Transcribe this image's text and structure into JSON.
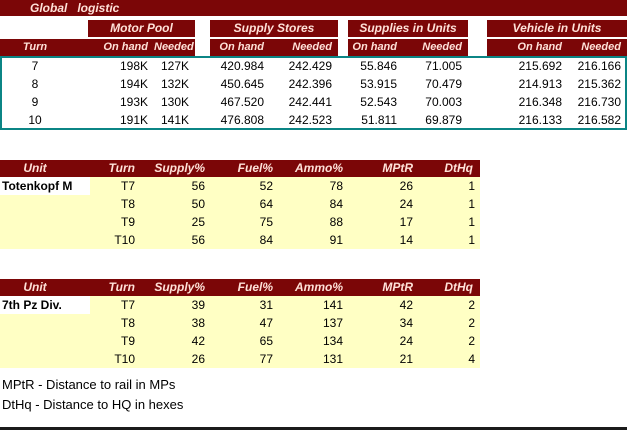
{
  "title": "Global   logistic",
  "colors": {
    "header_bg": "#7b0607",
    "header_text": "#ffe1d8",
    "table_border_teal": "#0b8585",
    "row_yellow": "#ffffc4"
  },
  "logistics": {
    "turn_col": "Turn",
    "groups": [
      {
        "label": "Motor Pool",
        "c1": "On hand",
        "c2": "Needed"
      },
      {
        "label": "Supply Stores",
        "c1": "On hand",
        "c2": "Needed"
      },
      {
        "label": "Supplies in Units",
        "c1": "On hand",
        "c2": "Needed"
      },
      {
        "label": "Vehicle in Units",
        "c1": "On hand",
        "c2": "Needed"
      }
    ],
    "rows": [
      {
        "turn": "7",
        "v": [
          "198K",
          "127K",
          "420.984",
          "242.429",
          "55.846",
          "71.005",
          "215.692",
          "216.166"
        ]
      },
      {
        "turn": "8",
        "v": [
          "194K",
          "132K",
          "450.645",
          "242.396",
          "53.915",
          "70.479",
          "214.913",
          "215.362"
        ]
      },
      {
        "turn": "9",
        "v": [
          "193K",
          "130K",
          "467.520",
          "242.441",
          "52.543",
          "70.003",
          "216.348",
          "216.730"
        ]
      },
      {
        "turn": "10",
        "v": [
          "191K",
          "141K",
          "476.808",
          "242.523",
          "51.811",
          "69.879",
          "216.133",
          "216.582"
        ]
      }
    ]
  },
  "unit_tables": [
    {
      "headers": [
        "Unit",
        "Turn",
        "Supply%",
        "Fuel%",
        "Ammo%",
        "MPtR",
        "DtHq"
      ],
      "unit": "Totenkopf M",
      "rows": [
        {
          "turn": "T7",
          "supply": "56",
          "fuel": "52",
          "ammo": "78",
          "mptr": "26",
          "dthq": "1"
        },
        {
          "turn": "T8",
          "supply": "50",
          "fuel": "64",
          "ammo": "84",
          "mptr": "24",
          "dthq": "1"
        },
        {
          "turn": "T9",
          "supply": "25",
          "fuel": "75",
          "ammo": "88",
          "mptr": "17",
          "dthq": "1"
        },
        {
          "turn": "T10",
          "supply": "56",
          "fuel": "84",
          "ammo": "91",
          "mptr": "14",
          "dthq": "1"
        }
      ]
    },
    {
      "headers": [
        "Unit",
        "Turn",
        "Supply%",
        "Fuel%",
        "Ammo%",
        "MPtR",
        "DtHq"
      ],
      "unit": "7th Pz Div.",
      "rows": [
        {
          "turn": "T7",
          "supply": "39",
          "fuel": "31",
          "ammo": "141",
          "mptr": "42",
          "dthq": "2"
        },
        {
          "turn": "T8",
          "supply": "38",
          "fuel": "47",
          "ammo": "137",
          "mptr": "34",
          "dthq": "2"
        },
        {
          "turn": "T9",
          "supply": "42",
          "fuel": "65",
          "ammo": "134",
          "mptr": "24",
          "dthq": "2"
        },
        {
          "turn": "T10",
          "supply": "26",
          "fuel": "77",
          "ammo": "131",
          "mptr": "21",
          "dthq": "4"
        }
      ]
    }
  ],
  "footnotes": [
    "MPtR - Distance to rail in MPs",
    "DtHq - Distance to HQ in hexes"
  ]
}
